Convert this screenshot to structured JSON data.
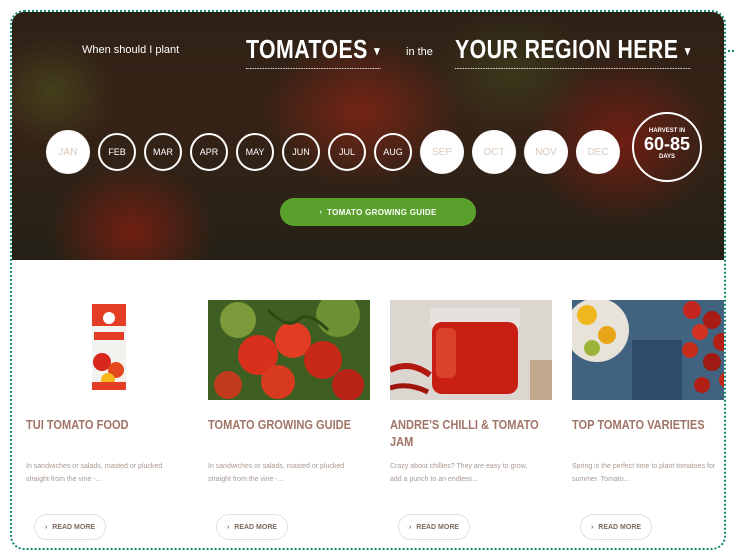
{
  "hero": {
    "question_label": "When should I plant",
    "crop_select": "TOMATOES",
    "in_the_label": "in the",
    "region_select": "YOUR REGION HERE",
    "months": [
      "JAN",
      "FEB",
      "MAR",
      "APR",
      "MAY",
      "JUN",
      "JUL",
      "AUG",
      "SEP",
      "OCT",
      "NOV",
      "DEC"
    ],
    "harvest": {
      "label_top": "HARVEST IN",
      "value": "60-85",
      "unit": "DAYS"
    },
    "guide_button": "TOMATO GROWING GUIDE"
  },
  "cards": [
    {
      "title": "TUI TOMATO FOOD",
      "desc": "In sandwiches or salads, roasted or plucked straight from the vine -...",
      "button": "READ MORE",
      "image": "tomato-food-bag"
    },
    {
      "title": "TOMATO GROWING GUIDE",
      "desc": "In sandwiches or salads, roasted or plucked straight from the vine -...",
      "button": "READ MORE",
      "image": "tomatoes-on-vine"
    },
    {
      "title": "ANDRE'S CHILLI & TOMATO JAM",
      "desc": "Crazy about chillies? They are easy to grow, add a punch to an endless...",
      "button": "READ MORE",
      "image": "chilli-jam-jar"
    },
    {
      "title": "TOP TOMATO VARIETIES",
      "desc": "Spring is the perfect time to plant tomatoes for summer. Tomato...",
      "button": "READ MORE",
      "image": "tomato-varieties"
    }
  ],
  "colors": {
    "accent_green": "#5aa02c",
    "frame_teal": "#0f8a73",
    "title_brown": "#a07567"
  }
}
